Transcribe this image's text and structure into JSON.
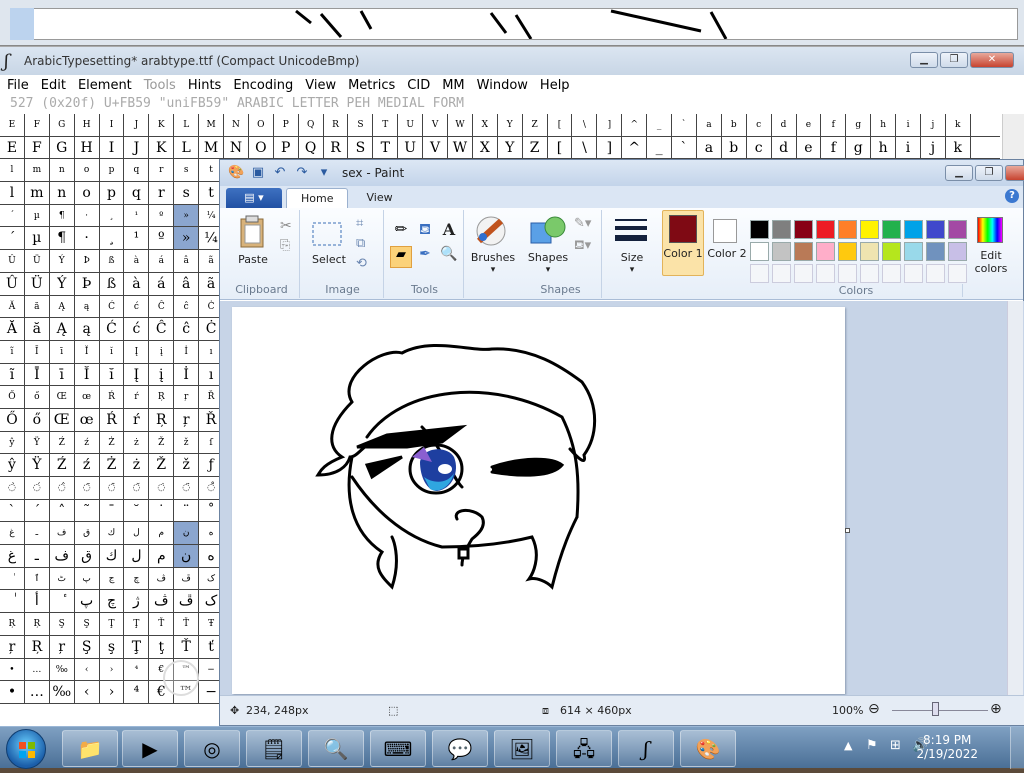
{
  "fontforge": {
    "title": "ArabicTypesetting*  arabtype.ttf (Compact UnicodeBmp)",
    "menu": [
      "File",
      "Edit",
      "Element",
      "Tools",
      "Hints",
      "Encoding",
      "View",
      "Metrics",
      "CID",
      "MM",
      "Window",
      "Help"
    ],
    "info": " 527  (0x20f)  U+FB59  \"uniFB59\"  ARABIC LETTER PEH MEDIAL FORM",
    "grid_rows": [
      [
        "E",
        "F",
        "G",
        "H",
        "I",
        "J",
        "K",
        "L",
        "M",
        "N",
        "O",
        "P",
        "Q",
        "R",
        "S",
        "T",
        "U",
        "V",
        "W",
        "X",
        "Y",
        "Z",
        "[",
        "\\",
        "]",
        "^",
        "_",
        "`",
        "a",
        "b",
        "c",
        "d",
        "e",
        "f",
        "g",
        "h",
        "i",
        "j",
        "k"
      ],
      [
        "E",
        "F",
        "G",
        "H",
        "I",
        "J",
        "K",
        "L",
        "M",
        "N",
        "O",
        "P",
        "Q",
        "R",
        "S",
        "T",
        "U",
        "V",
        "W",
        "X",
        "Y",
        "Z",
        "[",
        "\\",
        "]",
        "^",
        "_",
        "`",
        "a",
        "b",
        "c",
        "d",
        "e",
        "f",
        "g",
        "h",
        "i",
        "j",
        "k"
      ],
      [
        "l",
        "m",
        "n",
        "o",
        "p",
        "q",
        "r",
        "s",
        "t"
      ],
      [
        "l",
        "m",
        "n",
        "o",
        "p",
        "q",
        "r",
        "s",
        "t"
      ],
      [
        "´",
        "µ",
        "¶",
        "·",
        "¸",
        "¹",
        "º",
        "»",
        "¼"
      ],
      [
        "´",
        "µ",
        "¶",
        "·",
        "¸",
        "¹",
        "º",
        "»",
        "¼"
      ],
      [
        "Û",
        "Ü",
        "Ý",
        "Þ",
        "ß",
        "à",
        "á",
        "â",
        "ã"
      ],
      [
        "Û",
        "Ü",
        "Ý",
        "Þ",
        "ß",
        "à",
        "á",
        "â",
        "ã"
      ],
      [
        "Ă",
        "ă",
        "Ą",
        "ą",
        "Ć",
        "ć",
        "Ĉ",
        "ĉ",
        "Ċ"
      ],
      [
        "Ă",
        "ă",
        "Ą",
        "ą",
        "Ć",
        "ć",
        "Ĉ",
        "ĉ",
        "Ċ"
      ],
      [
        "ĩ",
        "Ī",
        "ī",
        "Ĭ",
        "ĭ",
        "Į",
        "į",
        "İ",
        "ı"
      ],
      [
        "ĩ",
        "Ī",
        "ī",
        "Ĭ",
        "ĭ",
        "Į",
        "į",
        "İ",
        "ı"
      ],
      [
        "Ő",
        "ő",
        "Œ",
        "œ",
        "Ŕ",
        "ŕ",
        "Ŗ",
        "ŗ",
        "Ř"
      ],
      [
        "Ő",
        "ő",
        "Œ",
        "œ",
        "Ŕ",
        "ŕ",
        "Ŗ",
        "ŗ",
        "Ř"
      ],
      [
        "ŷ",
        "Ÿ",
        "Ź",
        "ź",
        "Ż",
        "ż",
        "Ž",
        "ž",
        "ſ"
      ],
      [
        "ŷ",
        "Ÿ",
        "Ź",
        "ź",
        "Ż",
        "ż",
        "Ž",
        "ž",
        "ƒ"
      ],
      [
        "◌̀",
        "◌́",
        "◌̂",
        "◌̃",
        "◌̄",
        "◌̆",
        "◌̇",
        "◌̈",
        "◌̊"
      ],
      [
        "ˋ",
        "ˊ",
        "˄",
        "˜",
        "¯",
        "˘",
        "˙",
        "¨",
        "˚"
      ],
      [
        "غ",
        "ـ",
        "ف",
        "ق",
        "ك",
        "ل",
        "م",
        "ن",
        "ه"
      ],
      [
        "غ",
        "ـ",
        "ف",
        "ق",
        "ك",
        "ل",
        "م",
        "ن",
        "ه"
      ],
      [
        "ٰ",
        "ٱ",
        "ٹ",
        "پ",
        "ڃ",
        "چ",
        "ڤ",
        "ڦ",
        "ک"
      ],
      [
        "ٰ",
        "أ",
        "ٔ",
        "پ",
        "چ",
        "ژ",
        "ڤ",
        "ڦ",
        "ک"
      ],
      [
        "Ŗ",
        "Ŗ",
        "Ş",
        "Ş",
        "Ţ",
        "Ţ",
        "Ť",
        "Ť",
        "Ŧ"
      ],
      [
        "ŗ",
        "Ŗ",
        "ŗ",
        "Ş",
        "ş",
        "Ţ",
        "ţ",
        "Ť",
        "ť"
      ],
      [
        "•",
        "…",
        "‰",
        "‹",
        "›",
        "⁴",
        "€",
        "™",
        "−"
      ],
      [
        "•",
        "…",
        "‰",
        "‹",
        "›",
        "⁴",
        "€",
        "™",
        "−"
      ]
    ]
  },
  "paint": {
    "title": "sex - Paint",
    "tabs": [
      "Home",
      "View"
    ],
    "groups": {
      "clipboard": "Clipboard",
      "image": "Image",
      "tools": "Tools",
      "shapes": "Shapes",
      "colors": "Colors"
    },
    "buttons": {
      "paste": "Paste",
      "select": "Select",
      "brushes": "Brushes",
      "shapes": "Shapes",
      "size": "Size",
      "color1": "Color 1",
      "color2": "Color 2",
      "edit_colors": "Edit colors"
    },
    "color1_value": "#7f0a14",
    "color2_value": "#ffffff",
    "palette_row1": [
      "#000000",
      "#7f7f7f",
      "#880015",
      "#ed1c24",
      "#ff7f27",
      "#fff200",
      "#22b14c",
      "#00a2e8",
      "#3f48cc",
      "#a349a4"
    ],
    "palette_row2": [
      "#ffffff",
      "#c3c3c3",
      "#b97a57",
      "#ffaec9",
      "#ffc90e",
      "#efe4b0",
      "#b5e61d",
      "#99d9ea",
      "#7092be",
      "#c8bfe7"
    ],
    "status": {
      "cursor": "234, 248px",
      "size": "614 × 460px",
      "zoom": "100%"
    }
  },
  "taskbar": {
    "time": "8:19 PM",
    "date": "2/19/2022"
  }
}
